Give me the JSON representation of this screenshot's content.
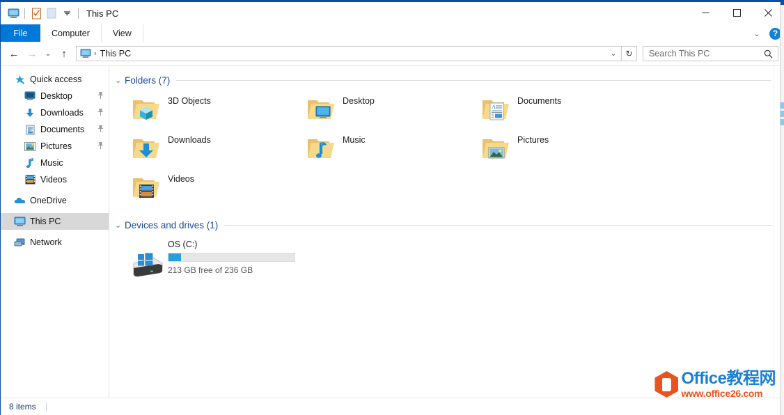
{
  "window": {
    "title": "This PC",
    "quick_access_toolbar": [
      {
        "name": "this-pc-icon",
        "label": "This PC"
      },
      {
        "name": "properties-icon",
        "label": "Properties"
      },
      {
        "name": "new-folder-icon",
        "label": "New folder"
      },
      {
        "name": "customize-qat-chevron",
        "label": "Customize Quick Access Toolbar"
      }
    ],
    "controls": {
      "minimize": "—",
      "maximize": "☐",
      "close": "✕"
    }
  },
  "ribbon": {
    "tabs": [
      {
        "label": "File",
        "active": true
      },
      {
        "label": "Computer",
        "active": false
      },
      {
        "label": "View",
        "active": false
      }
    ],
    "collapse_icon": "⌄",
    "help_label": "?"
  },
  "navbar": {
    "back": "←",
    "forward": "→",
    "recent": "⌄",
    "up": "↑",
    "address": {
      "icon": "this-pc-icon",
      "separator": "›",
      "crumb": "This PC",
      "dropdown": "⌄"
    },
    "refresh": "↻"
  },
  "search": {
    "placeholder": "Search This PC",
    "value": "",
    "icon": "search-icon"
  },
  "sidebar": {
    "items": [
      {
        "label": "Quick access",
        "icon": "star-pin-icon",
        "level": "root",
        "pinned": false,
        "selected": false
      },
      {
        "label": "Desktop",
        "icon": "desktop-icon",
        "level": "child",
        "pinned": true,
        "selected": false
      },
      {
        "label": "Downloads",
        "icon": "download-arrow-icon",
        "level": "child",
        "pinned": true,
        "selected": false
      },
      {
        "label": "Documents",
        "icon": "document-icon",
        "level": "child",
        "pinned": true,
        "selected": false
      },
      {
        "label": "Pictures",
        "icon": "picture-icon",
        "level": "child",
        "pinned": true,
        "selected": false
      },
      {
        "label": "Music",
        "icon": "music-note-icon",
        "level": "child",
        "pinned": false,
        "selected": false
      },
      {
        "label": "Videos",
        "icon": "film-strip-icon",
        "level": "child",
        "pinned": false,
        "selected": false
      },
      {
        "label": "OneDrive",
        "icon": "cloud-icon",
        "level": "root",
        "pinned": false,
        "selected": false
      },
      {
        "label": "This PC",
        "icon": "this-pc-icon",
        "level": "root",
        "pinned": false,
        "selected": true
      },
      {
        "label": "Network",
        "icon": "network-icon",
        "level": "root",
        "pinned": false,
        "selected": false
      }
    ],
    "pin_glyph": "📌"
  },
  "content": {
    "groups": [
      {
        "title": "Folders (7)",
        "chevron": "⌄",
        "items": [
          {
            "label": "3D Objects",
            "icon": "folder-3d-objects-icon"
          },
          {
            "label": "Desktop",
            "icon": "folder-desktop-icon"
          },
          {
            "label": "Downloads",
            "icon": "folder-downloads-icon"
          },
          {
            "label": "Music",
            "icon": "folder-music-icon"
          },
          {
            "label": "Documents",
            "icon": "folder-documents-icon"
          },
          {
            "label": "Pictures",
            "icon": "folder-pictures-icon"
          },
          {
            "label": "Videos",
            "icon": "folder-videos-icon"
          }
        ]
      },
      {
        "title": "Devices and drives (1)",
        "chevron": "⌄",
        "drives": [
          {
            "name": "OS (C:)",
            "icon": "hard-drive-windows-icon",
            "free_text": "213 GB free of 236 GB",
            "used_percent": 10
          }
        ]
      }
    ]
  },
  "statusbar": {
    "item_count": "8 items"
  },
  "watermark": {
    "line1": "Office教程网",
    "line2": "www.office26.com",
    "logo": "office-logo-icon"
  },
  "colors": {
    "accent": "#0078d7",
    "titlebar_border": "#0a4fa0",
    "group_header": "#1b4b96",
    "drive_bar_fill": "#26a0da",
    "selection": "#d8d8d8",
    "status_text": "#1f3864",
    "watermark_blue": "#1b7fd4",
    "watermark_orange": "#e8541f"
  }
}
